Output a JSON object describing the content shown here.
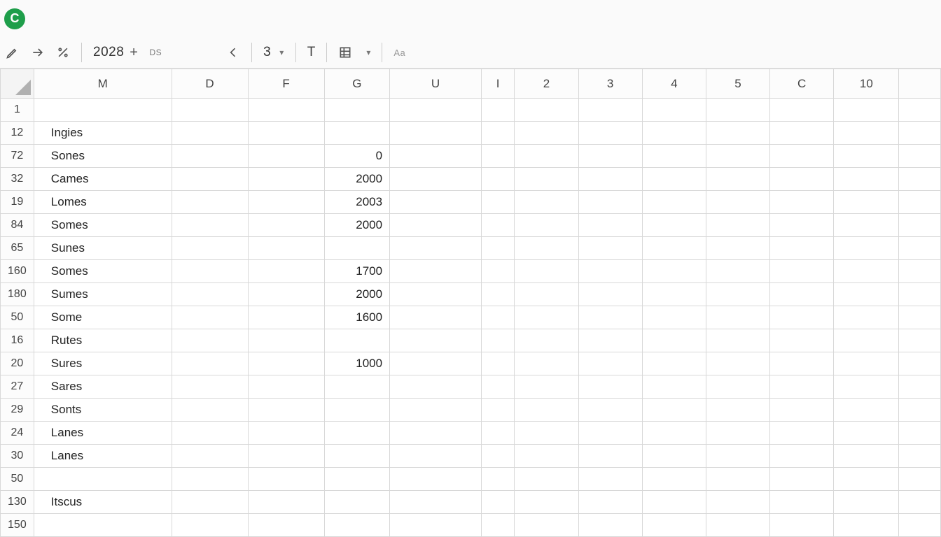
{
  "logo": {
    "letter": "C"
  },
  "toolbar": {
    "number_box": "2028",
    "ds_label": "DS",
    "small_num": "3",
    "text_glyph": "T",
    "aa_glyph": "Aa"
  },
  "columns": [
    {
      "key": "M",
      "label": "M"
    },
    {
      "key": "D",
      "label": "D"
    },
    {
      "key": "F",
      "label": "F"
    },
    {
      "key": "G",
      "label": "G"
    },
    {
      "key": "U",
      "label": "U"
    },
    {
      "key": "I",
      "label": "I"
    },
    {
      "key": "2",
      "label": "2"
    },
    {
      "key": "3",
      "label": "3"
    },
    {
      "key": "4",
      "label": "4"
    },
    {
      "key": "5",
      "label": "5"
    },
    {
      "key": "C",
      "label": "C"
    },
    {
      "key": "10",
      "label": "10"
    },
    {
      "key": "X",
      "label": ""
    }
  ],
  "rows": [
    {
      "hdr": "1",
      "M": "",
      "G": ""
    },
    {
      "hdr": "12",
      "M": "Ingies",
      "G": ""
    },
    {
      "hdr": "72",
      "M": "Sones",
      "G": "0"
    },
    {
      "hdr": "32",
      "M": "Cames",
      "G": "2000"
    },
    {
      "hdr": "19",
      "M": "Lomes",
      "G": "2003"
    },
    {
      "hdr": "84",
      "M": "Somes",
      "G": "2000"
    },
    {
      "hdr": "65",
      "M": "Sunes",
      "G": ""
    },
    {
      "hdr": "160",
      "M": "Somes",
      "G": "1700"
    },
    {
      "hdr": "180",
      "M": "Sumes",
      "G": "2000"
    },
    {
      "hdr": "50",
      "M": "Some",
      "G": "1600"
    },
    {
      "hdr": "16",
      "M": "Rutes",
      "G": ""
    },
    {
      "hdr": "20",
      "M": "Sures",
      "G": "1000"
    },
    {
      "hdr": "27",
      "M": "Sares",
      "G": ""
    },
    {
      "hdr": "29",
      "M": "Sonts",
      "G": ""
    },
    {
      "hdr": "24",
      "M": "Lanes",
      "G": ""
    },
    {
      "hdr": "30",
      "M": "Lanes",
      "G": ""
    },
    {
      "hdr": "50",
      "M": "",
      "G": ""
    },
    {
      "hdr": "130",
      "M": "Itscus",
      "G": ""
    },
    {
      "hdr": "150",
      "M": "",
      "G": ""
    }
  ]
}
